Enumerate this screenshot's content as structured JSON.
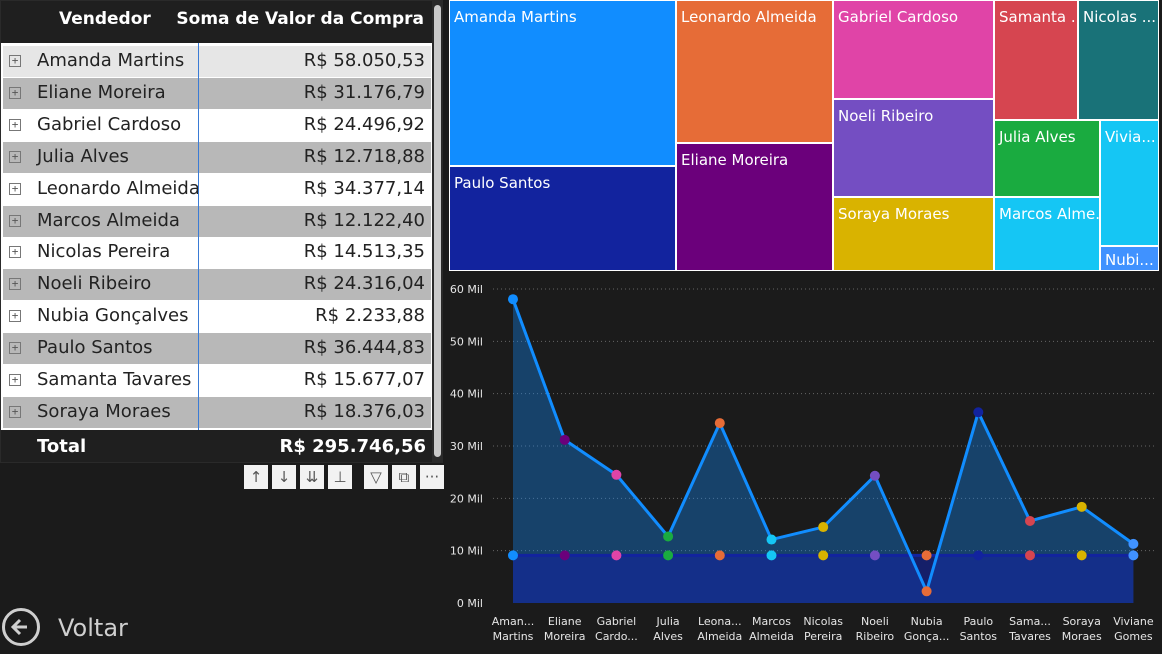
{
  "matrix": {
    "col_vendedor": "Vendedor",
    "col_soma": "Soma de Valor da Compra",
    "rows": [
      {
        "name": "Amanda Martins",
        "value": "R$ 58.050,53"
      },
      {
        "name": "Eliane Moreira",
        "value": "R$ 31.176,79"
      },
      {
        "name": "Gabriel Cardoso",
        "value": "R$ 24.496,92"
      },
      {
        "name": "Julia Alves",
        "value": "R$ 12.718,88"
      },
      {
        "name": "Leonardo Almeida",
        "value": "R$ 34.377,14"
      },
      {
        "name": "Marcos Almeida",
        "value": "R$ 12.122,40"
      },
      {
        "name": "Nicolas Pereira",
        "value": "R$ 14.513,35"
      },
      {
        "name": "Noeli Ribeiro",
        "value": "R$ 24.316,04"
      },
      {
        "name": "Nubia Gonçalves",
        "value": "R$ 2.233,88"
      },
      {
        "name": "Paulo Santos",
        "value": "R$ 36.444,83"
      },
      {
        "name": "Samanta Tavares",
        "value": "R$ 15.677,07"
      },
      {
        "name": "Soraya Moraes",
        "value": "R$ 18.376,03"
      }
    ],
    "total_label": "Total",
    "total_value": "R$ 295.746,56",
    "expand_glyph": "+"
  },
  "toolbar": {
    "icons": [
      "arrow-up-icon",
      "arrow-down-icon",
      "double-arrow-down-icon",
      "expand-hierarchy-icon",
      "filter-icon",
      "focus-mode-icon",
      "more-options-icon"
    ],
    "more_glyph": "···"
  },
  "back": {
    "label": "Voltar"
  },
  "treemap": {
    "tiles": [
      {
        "label": "Amanda Martins",
        "color": "#118DFF"
      },
      {
        "label": "Paulo Santos",
        "color": "#12239E"
      },
      {
        "label": "Leonardo Almeida",
        "color": "#E66C37"
      },
      {
        "label": "Eliane Moreira",
        "color": "#6B007B"
      },
      {
        "label": "Gabriel Cardoso",
        "color": "#E044A7"
      },
      {
        "label": "Noeli Ribeiro",
        "color": "#744EC2"
      },
      {
        "label": "Soraya Moraes",
        "color": "#D9B300"
      },
      {
        "label": "Samanta ...",
        "color": "#D64550"
      },
      {
        "label": "Nicolas ...",
        "color": "#197278"
      },
      {
        "label": "Julia Alves",
        "color": "#1AAB40"
      },
      {
        "label": "Vivia...",
        "color": "#15C6F4"
      },
      {
        "label": "Marcos Alme...",
        "color": "#15C6F4"
      },
      {
        "label": "Nubi...",
        "color": "#4092FF"
      }
    ]
  },
  "chart_data": {
    "type": "area",
    "categories": [
      "Aman... Martins",
      "Eliane Moreira",
      "Gabriel Cardo...",
      "Julia Alves",
      "Leona... Almeida",
      "Marcos Almeida",
      "Nicolas Pereira",
      "Noeli Ribeiro",
      "Nubia Gonça...",
      "Paulo Santos",
      "Sama... Tavares",
      "Soraya Moraes",
      "Viviane Gomes"
    ],
    "series": [
      {
        "values": [
          58050.53,
          31176.79,
          24496.92,
          12718.88,
          34377.14,
          12122.4,
          14513.35,
          24316.04,
          2233.88,
          36444.83,
          15677.07,
          18376.03,
          11300
        ],
        "color": "#118DFF"
      },
      {
        "values": [
          9100,
          9100,
          9100,
          9100,
          9100,
          9100,
          9100,
          9100,
          9100,
          9100,
          9100,
          9100,
          9100
        ],
        "color": "#12239E"
      }
    ],
    "point_colors": [
      "#118DFF",
      "#6B007B",
      "#E044A7",
      "#1AAB40",
      "#E66C37",
      "#15C6F4",
      "#D9B300",
      "#744EC2",
      "#E66C37",
      "#12239E",
      "#D64550",
      "#D9B300",
      "#4092FF"
    ],
    "ytick_labels": [
      "0 Mil",
      "10 Mil",
      "20 Mil",
      "30 Mil",
      "40 Mil",
      "50 Mil",
      "60 Mil"
    ],
    "ylim": [
      0,
      60000
    ],
    "grid": true,
    "title": "",
    "xlabel": "",
    "ylabel": ""
  }
}
